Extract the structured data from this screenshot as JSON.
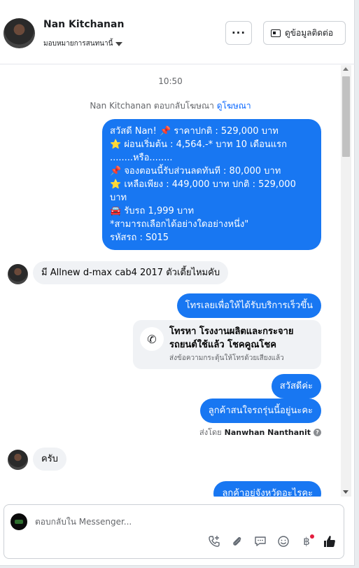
{
  "header": {
    "contact_name": "Nan Kitchanan",
    "assign_label": "มอบหมายการสนทนานี้",
    "more_label": "···",
    "info_button_label": "ดูข้อมูลติดต่อ"
  },
  "chat": {
    "timestamp": "10:50",
    "ad_reply_text": "Nan Kitchanan ตอบกลับโฆษณา",
    "ad_link_text": "ดูโฆษณา",
    "ad_message_lines": [
      "สวัสดี Nan! 📌 ราคาปกติ : 529,000 บาท",
      "⭐ ผ่อนเริ่มต้น : 4,564.-* บาท 10 เดือนแรก",
      "........หรือ........",
      "📌 จองตอนนี้รับส่วนลดทันที : 80,000 บาท",
      "⭐ เหลือเพียง : 449,000 บาท ปกติ : 529,000",
      "บาท",
      "🚘 รับรถ 1,999 บาท",
      "*สามารถเลือกได้อย่างใดอย่างหนึ่ง\"",
      "รหัสรถ : S015"
    ],
    "customer_msg_1": "มี Allnew d-max cab4 2017 ตัวเตี้ยไหมคับ",
    "outgoing_call_prompt": "โทรเลยเพื่อให้ได้รับบริการเร็วขึ้น",
    "call_card_title": "โทรหา โรงงานผลิตและกระจาย รถยนต์ใช้แล้ว โชคคูณโชค",
    "call_card_sub": "ส่งข้อความกระตุ้นให้โทรด้วยเสียงแล้ว",
    "outgoing_hello": "สวัสดีค่ะ",
    "outgoing_interest": "ลูกค้าสนใจรถรุ่นนี้อยู่นะคะ",
    "sent_by_prefix": "ส่งโดย",
    "sent_by_name": "Nanwhan Nanthanit",
    "customer_msg_2": "ครับ",
    "outgoing_province": "ลูกค้าอยู่จังหวัดอะไรคะ"
  },
  "composer": {
    "placeholder": "ตอบกลับใน Messenger..."
  },
  "colors": {
    "outgoing_bubble": "#1877f2",
    "incoming_bubble": "#f0f2f5",
    "link": "#0866ff",
    "like": "#1c1e21"
  }
}
